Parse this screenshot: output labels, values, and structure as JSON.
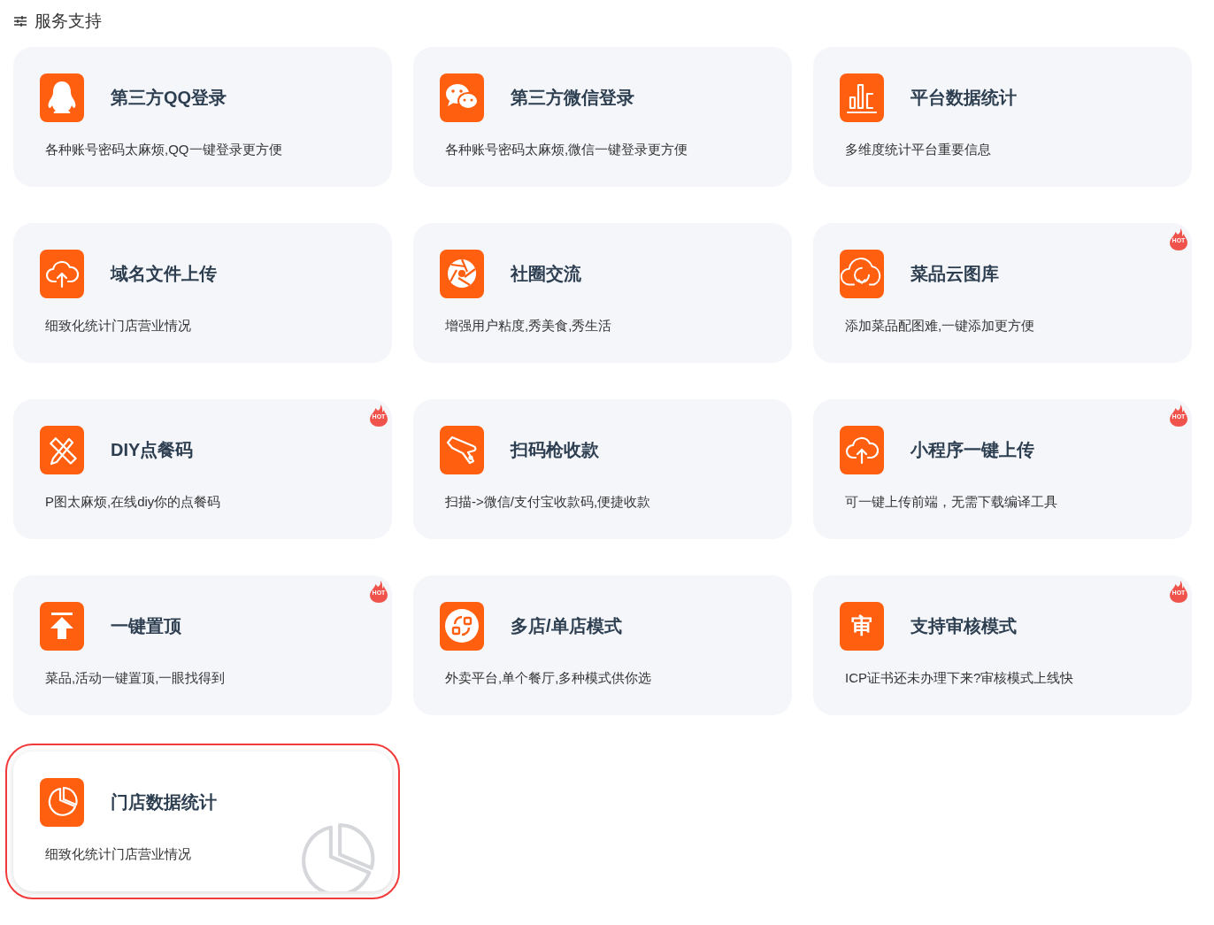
{
  "section": {
    "title": "服务支持"
  },
  "cards": [
    {
      "title": "第三方QQ登录",
      "description": "各种账号密码太麻烦,QQ一键登录更方便",
      "kind": "penguin",
      "selected": false
    },
    {
      "title": "第三方微信登录",
      "description": "各种账号密码太麻烦,微信一键登录更方便",
      "kind": "chat",
      "selected": false
    },
    {
      "title": "平台数据统计",
      "description": "多维度统计平台重要信息",
      "kind": "bars",
      "selected": false
    },
    {
      "title": "域名文件上传",
      "description": "细致化统计门店营业情况",
      "kind": "upload",
      "selected": false
    },
    {
      "title": "社圈交流",
      "description": "增强用户粘度,秀美食,秀生活",
      "kind": "aperture",
      "selected": false
    },
    {
      "title": "菜品云图库",
      "description": "添加菜品配图难,一键添加更方便",
      "kind": "download",
      "badge": "HOT",
      "selected": false
    },
    {
      "title": "DIY点餐码",
      "description": "P图太麻烦,在线diy你的点餐码",
      "kind": "tools",
      "badge": "HOT",
      "selected": false
    },
    {
      "title": "扫码枪收款",
      "description": "扫描->微信/支付宝收款码,便捷收款",
      "kind": "scanner",
      "selected": false
    },
    {
      "title": "小程序一键上传",
      "description": "可一键上传前端，无需下载编译工具",
      "kind": "upload",
      "badge": "HOT",
      "selected": false
    },
    {
      "title": "一键置顶",
      "description": "菜品,活动一键置顶,一眼找得到",
      "kind": "totop",
      "badge": "HOT",
      "selected": false
    },
    {
      "title": "多店/单店模式",
      "description": "外卖平台,单个餐厅,多种模式供你选",
      "kind": "switch",
      "selected": false
    },
    {
      "title": "支持审核模式",
      "description": "ICP证书还未办理下来?审核模式上线快",
      "kind": "glyph",
      "icon_text": "审",
      "badge": "HOT",
      "selected": false
    },
    {
      "title": "门店数据统计",
      "description": "细致化统计门店营业情况",
      "kind": "pie",
      "selected": true
    }
  ]
}
